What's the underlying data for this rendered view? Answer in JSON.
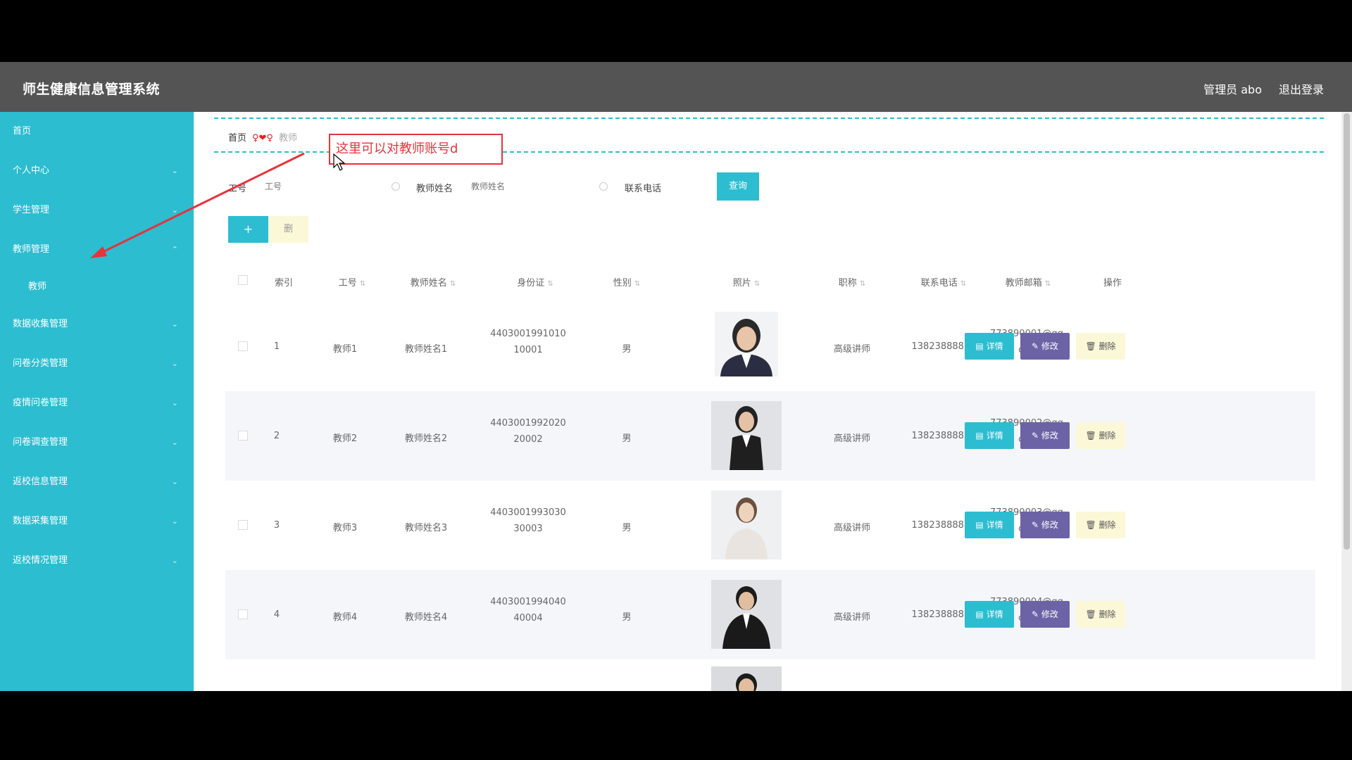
{
  "header": {
    "title": "师生健康信息管理系统",
    "user": "管理员 abo",
    "logout": "退出登录"
  },
  "sidebar": {
    "items": [
      {
        "label": "首页",
        "chevron": ""
      },
      {
        "label": "个人中心",
        "chevron": "⌄"
      },
      {
        "label": "学生管理",
        "chevron": "⌄"
      },
      {
        "label": "教师管理",
        "chevron": "⌃"
      },
      {
        "label": "数据收集管理",
        "chevron": "⌄"
      },
      {
        "label": "问卷分类管理",
        "chevron": "⌄"
      },
      {
        "label": "疫情问卷管理",
        "chevron": "⌄"
      },
      {
        "label": "问卷调查管理",
        "chevron": "⌄"
      },
      {
        "label": "返校信息管理",
        "chevron": "⌄"
      },
      {
        "label": "数据采集管理",
        "chevron": "⌄"
      },
      {
        "label": "返校情况管理",
        "chevron": "⌄"
      }
    ],
    "sub_item": "教师"
  },
  "breadcrumb": {
    "home": "首页",
    "sep": "♀❤♀",
    "current": "教师"
  },
  "annotation": "这里可以对教师账号d",
  "search": {
    "f1_label": "工号",
    "f1_placeholder": "工号",
    "f2_label": "教师姓名",
    "f2_placeholder": "教师姓名",
    "f3_label": "联系电话",
    "f3_placeholder": "联系电话",
    "button": "查询"
  },
  "actions": {
    "add": "+",
    "delete": "删"
  },
  "table": {
    "headers": [
      "索引",
      "工号",
      "教师姓名",
      "身份证",
      "性别",
      "照片",
      "职称",
      "联系电话",
      "教师邮箱",
      "操作"
    ],
    "sort_icon": "⇅",
    "op_detail": "详情",
    "op_edit": "修改",
    "op_delete": "删除",
    "rows": [
      {
        "idx": "1",
        "no": "教师1",
        "name": "教师姓名1",
        "id1": "4403001991010",
        "id2": "10001",
        "sex": "男",
        "title": "高级讲师",
        "phone": "13823888881",
        "mail1": "773890001@qq.",
        "mail2": "com"
      },
      {
        "idx": "2",
        "no": "教师2",
        "name": "教师姓名2",
        "id1": "4403001992020",
        "id2": "20002",
        "sex": "男",
        "title": "高级讲师",
        "phone": "13823888882",
        "mail1": "773890002@qq.",
        "mail2": "com"
      },
      {
        "idx": "3",
        "no": "教师3",
        "name": "教师姓名3",
        "id1": "4403001993030",
        "id2": "30003",
        "sex": "男",
        "title": "高级讲师",
        "phone": "13823888883",
        "mail1": "773890003@qq.",
        "mail2": "com"
      },
      {
        "idx": "4",
        "no": "教师4",
        "name": "教师姓名4",
        "id1": "4403001994040",
        "id2": "40004",
        "sex": "男",
        "title": "高级讲师",
        "phone": "13823888884",
        "mail1": "773890004@qq.",
        "mail2": "com"
      }
    ]
  },
  "colors": {
    "accent": "#2cbdd0",
    "edit": "#6b63a6",
    "danger_bg": "#fbf8d8",
    "annotation": "#e8323c"
  }
}
